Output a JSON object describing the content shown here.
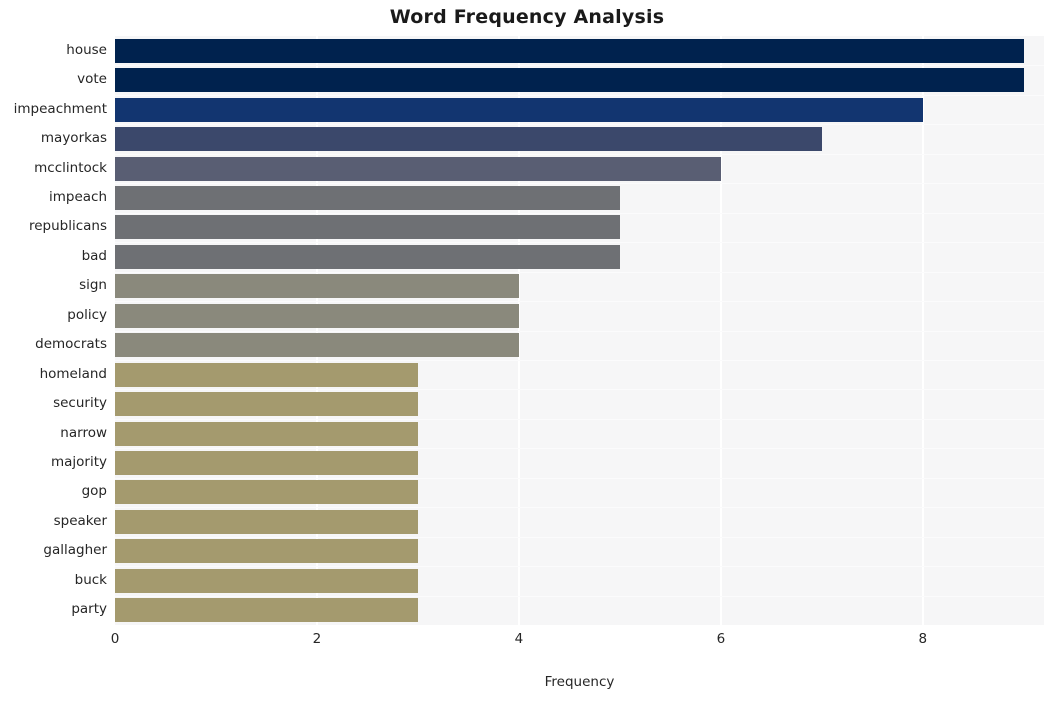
{
  "chart_data": {
    "type": "bar",
    "orientation": "horizontal",
    "title": "Word Frequency Analysis",
    "xlabel": "Frequency",
    "ylabel": "",
    "xlim": [
      0,
      9.2
    ],
    "xticks": [
      0,
      2,
      4,
      6,
      8
    ],
    "xticklabels": [
      "0",
      "2",
      "4",
      "6",
      "8"
    ],
    "grid": true,
    "legend": false,
    "categories": [
      "house",
      "vote",
      "impeachment",
      "mayorkas",
      "mcclintock",
      "impeach",
      "republicans",
      "bad",
      "sign",
      "policy",
      "democrats",
      "homeland",
      "security",
      "narrow",
      "majority",
      "gop",
      "speaker",
      "gallagher",
      "buck",
      "party"
    ],
    "values": [
      9,
      9,
      8,
      7,
      6,
      5,
      5,
      5,
      4,
      4,
      4,
      3,
      3,
      3,
      3,
      3,
      3,
      3,
      3,
      3
    ],
    "bar_colors": [
      "#00224e",
      "#00224e",
      "#123570",
      "#3b486b",
      "#595e73",
      "#6e7074",
      "#6e7074",
      "#6e7074",
      "#8a897c",
      "#8a897c",
      "#8a897c",
      "#a49a6e",
      "#a49a6e",
      "#a49a6e",
      "#a49a6e",
      "#a49a6e",
      "#a49a6e",
      "#a49a6e",
      "#a49a6e",
      "#a49a6e"
    ],
    "plot_background": "#f6f6f7",
    "gridline_color": "#ffffff",
    "text_color": "#262626"
  }
}
